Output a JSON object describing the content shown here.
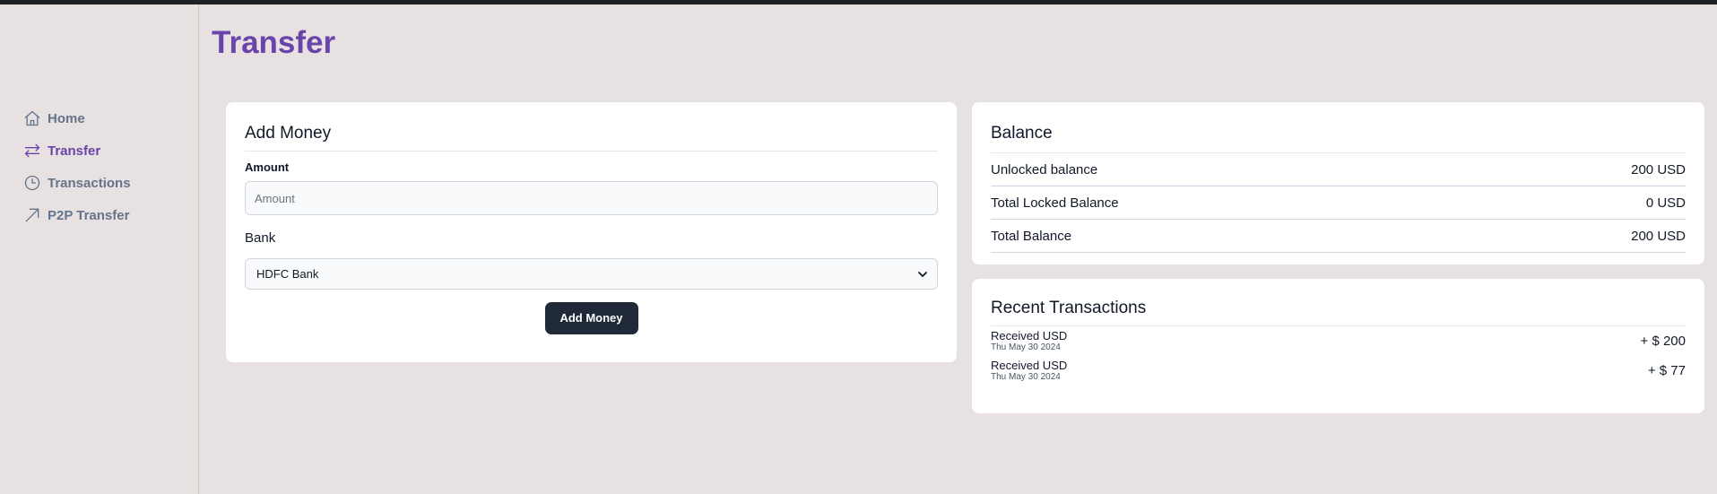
{
  "page": {
    "title": "Transfer"
  },
  "colors": {
    "accent": "#6a44a8",
    "background": "#e8e1e1",
    "button": "#1f2937",
    "muted": "#64748b"
  },
  "sidebar": {
    "items": [
      {
        "label": "Home",
        "icon": "home-icon",
        "active": false
      },
      {
        "label": "Transfer",
        "icon": "transfer-arrows-icon",
        "active": true
      },
      {
        "label": "Transactions",
        "icon": "clock-icon",
        "active": false
      },
      {
        "label": "P2P Transfer",
        "icon": "arrow-up-right-icon",
        "active": false
      }
    ]
  },
  "add_money": {
    "title": "Add Money",
    "amount_label": "Amount",
    "amount_placeholder": "Amount",
    "amount_value": "",
    "bank_label": "Bank",
    "bank_selected": "HDFC Bank",
    "button_label": "Add Money"
  },
  "balance": {
    "title": "Balance",
    "rows": [
      {
        "label": "Unlocked balance",
        "value": "200 USD"
      },
      {
        "label": "Total Locked Balance",
        "value": "0 USD"
      },
      {
        "label": "Total Balance",
        "value": "200 USD"
      }
    ]
  },
  "recent": {
    "title": "Recent Transactions",
    "items": [
      {
        "title": "Received USD",
        "date": "Thu May 30 2024",
        "amount": "+ $ 200"
      },
      {
        "title": "Received USD",
        "date": "Thu May 30 2024",
        "amount": "+ $ 77"
      }
    ]
  }
}
